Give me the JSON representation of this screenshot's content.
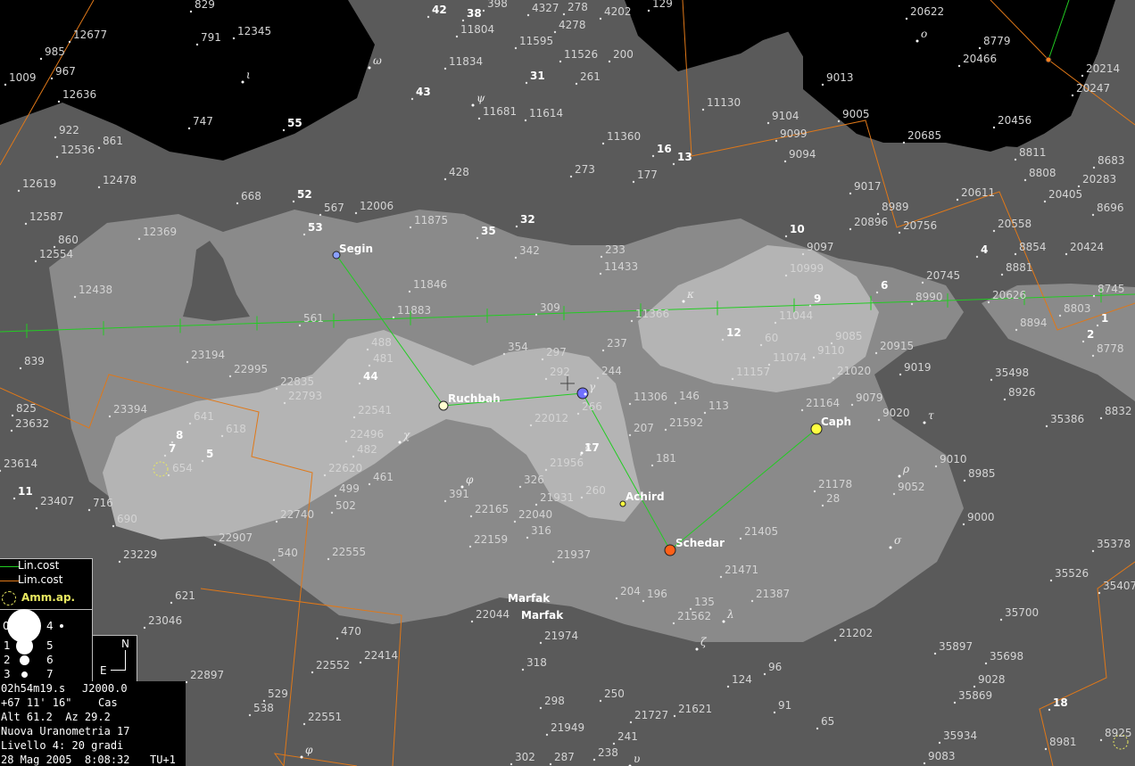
{
  "colors": {
    "sky": "#000000",
    "milkyway_band1": "#5a5a5a",
    "milkyway_band2": "#8a8a8a",
    "milkyway_band3": "#b4b4b4",
    "constellation_lines": "#22cc22",
    "constellation_bounds": "#e07818",
    "ecliptic": "#22cc22"
  },
  "star_names": [
    "Segin",
    "Ruchbah",
    "Achird",
    "Schedar",
    "Caph",
    "Marfak",
    "Marfak"
  ],
  "greek_labels": [
    "ω",
    "ψ",
    "ι",
    "κ",
    "γ",
    "χ",
    "φ",
    "ε",
    "ζ",
    "λ",
    "ρ",
    "σ",
    "τ",
    "ο",
    "υ",
    "φ"
  ],
  "catalog_labels": [
    "829",
    "42",
    "38",
    "398",
    "4327",
    "278",
    "4202",
    "129",
    "20622",
    "12677",
    "791",
    "12345",
    "11804",
    "11595",
    "4278",
    "985",
    "967",
    "11834",
    "11526",
    "200",
    "8779",
    "20466",
    "20214",
    "1009",
    "12636",
    "31",
    "261",
    "9013",
    "20247",
    "43",
    "11681",
    "11614",
    "11130",
    "747",
    "55",
    "922",
    "12536",
    "861",
    "11360",
    "16",
    "13",
    "9104",
    "9005",
    "20456",
    "9099",
    "9094",
    "20685",
    "8811",
    "273",
    "177",
    "428",
    "8683",
    "12619",
    "12478",
    "8808",
    "20283",
    "9017",
    "20611",
    "20405",
    "668",
    "52",
    "567",
    "12006",
    "8989",
    "8696",
    "12587",
    "11875",
    "53",
    "35",
    "32",
    "20896",
    "20756",
    "20558",
    "12369",
    "860",
    "12554",
    "10",
    "9097",
    "8854",
    "20424",
    "233",
    "342",
    "4",
    "10999",
    "11433",
    "8881",
    "20745",
    "12438",
    "11846",
    "9",
    "6",
    "8990",
    "20626",
    "8745",
    "11883",
    "309",
    "561",
    "11366",
    "11044",
    "8803",
    "1",
    "8894",
    "12",
    "60",
    "9085",
    "2",
    "488",
    "354",
    "237",
    "20915",
    "481",
    "297",
    "9110",
    "8778",
    "839",
    "23194",
    "22995",
    "11074",
    "9019",
    "35498",
    "44",
    "292",
    "244",
    "11157",
    "21020",
    "22835",
    "8926",
    "22793",
    "11306",
    "146",
    "9079",
    "825",
    "23394",
    "266",
    "113",
    "21164",
    "9020",
    "35386",
    "8832",
    "22541",
    "23632",
    "641",
    "22012",
    "21592",
    "618",
    "207",
    "8",
    "22496",
    "482",
    "181",
    "23614",
    "5",
    "9010",
    "21956",
    "8985",
    "22620",
    "461",
    "326",
    "21178",
    "11",
    "499",
    "391",
    "21931",
    "260",
    "9052",
    "23407",
    "716",
    "502",
    "22165",
    "28",
    "22040",
    "9000",
    "690",
    "22740",
    "316",
    "22907",
    "22159",
    "21405",
    "23229",
    "540",
    "21937",
    "22555",
    "35378",
    "21471",
    "35526",
    "621",
    "204",
    "196",
    "135",
    "21387",
    "35407",
    "22044",
    "23046",
    "21562",
    "35700",
    "470",
    "21974",
    "21202",
    "35897",
    "22414",
    "318",
    "22552",
    "35698",
    "124",
    "96",
    "22897",
    "9028",
    "529",
    "298",
    "250",
    "21727",
    "21621",
    "91",
    "35869",
    "538",
    "22551",
    "21949",
    "65",
    "35934",
    "241",
    "8981",
    "8925",
    "238",
    "302",
    "287",
    "9083",
    "18",
    "654",
    "7",
    "17"
  ],
  "legend": {
    "lin_cost": "Lin.cost",
    "lim_cost": "Lim.cost",
    "amm_ap": "Amm.ap.",
    "mags": [
      "0",
      "1",
      "2",
      "3",
      "4",
      "5",
      "6",
      "7"
    ]
  },
  "compass": {
    "north": "N",
    "east": "E"
  },
  "info": {
    "ra": "02h54m19.s",
    "epoch": "J2000.0",
    "dec": "+67 11' 16\"",
    "constellation": "Cas",
    "altaz": "Alt 61.2  Az 29.2",
    "atlas": "Nuova Uranometria 17",
    "level": "Livello 4: 20 gradi",
    "date": "28 Mag 2005  8:08:32",
    "tz": "TU+1"
  }
}
